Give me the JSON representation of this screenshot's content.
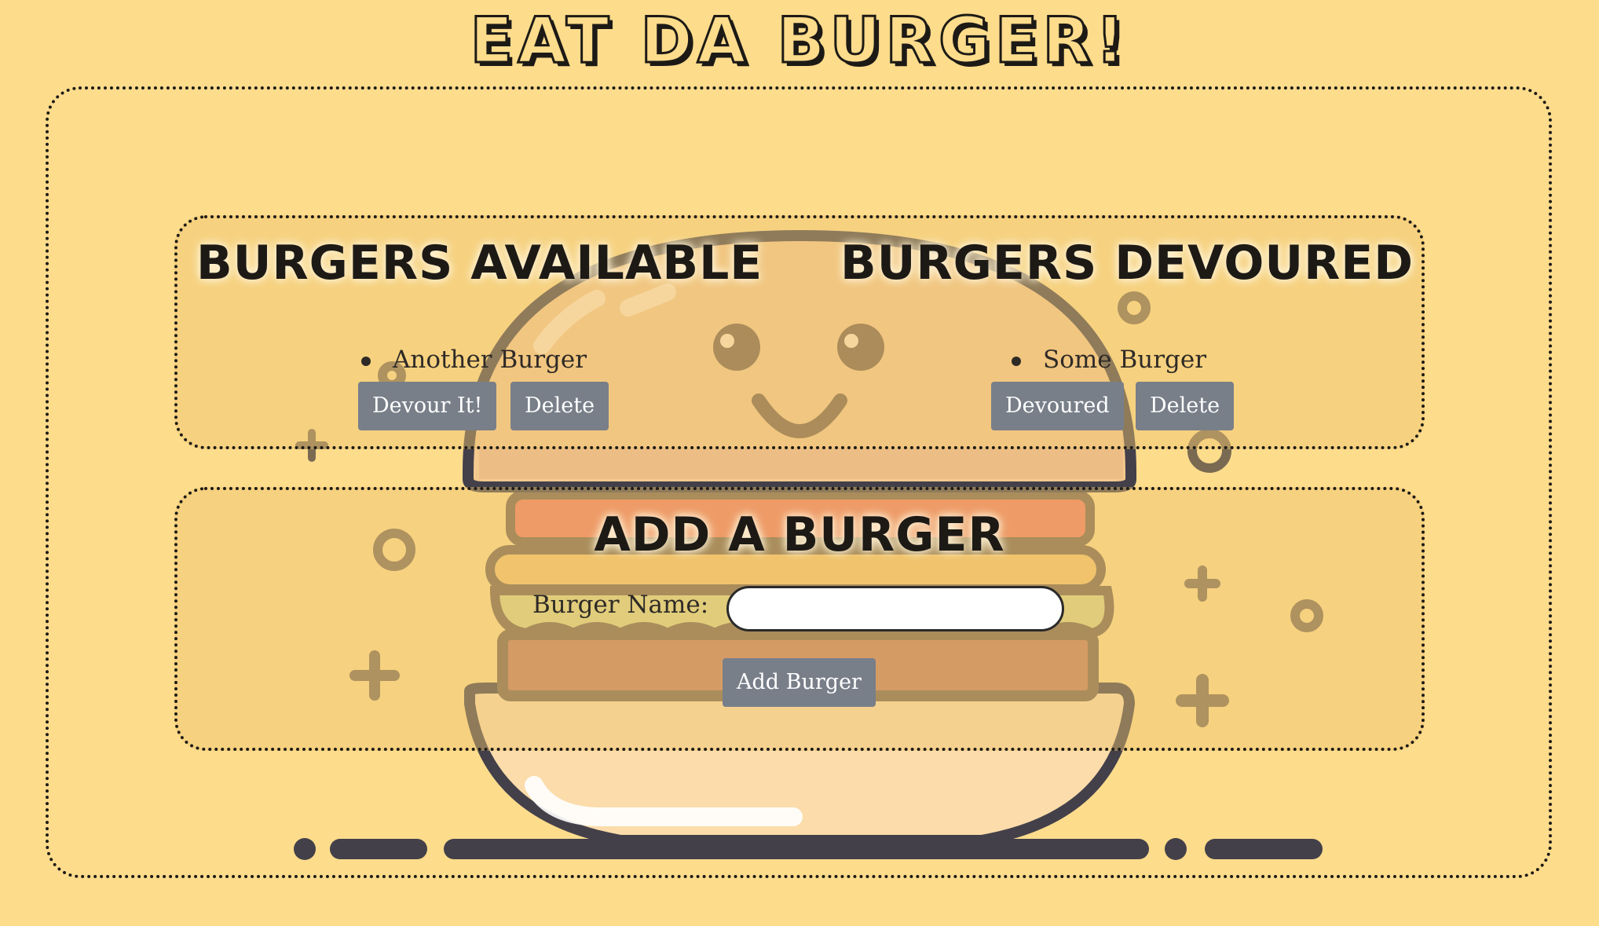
{
  "page": {
    "title": "EAT DA BURGER!"
  },
  "available": {
    "heading": "BURGERS AVAILABLE",
    "items": [
      {
        "name": "Another Burger",
        "devour_label": "Devour It!",
        "delete_label": "Delete"
      }
    ]
  },
  "devoured": {
    "heading": "BURGERS DEVOURED",
    "items": [
      {
        "name": "Some Burger",
        "status_label": "Devoured",
        "delete_label": "Delete"
      }
    ]
  },
  "add_form": {
    "heading": "ADD A BURGER",
    "name_label": "Burger Name:",
    "name_value": "",
    "submit_label": "Add Burger"
  },
  "colors": {
    "background": "#fddc8c",
    "button": "#787f89",
    "ink": "#1d1a16"
  },
  "icons": {
    "background_art": "smiling-burger-illustration"
  }
}
